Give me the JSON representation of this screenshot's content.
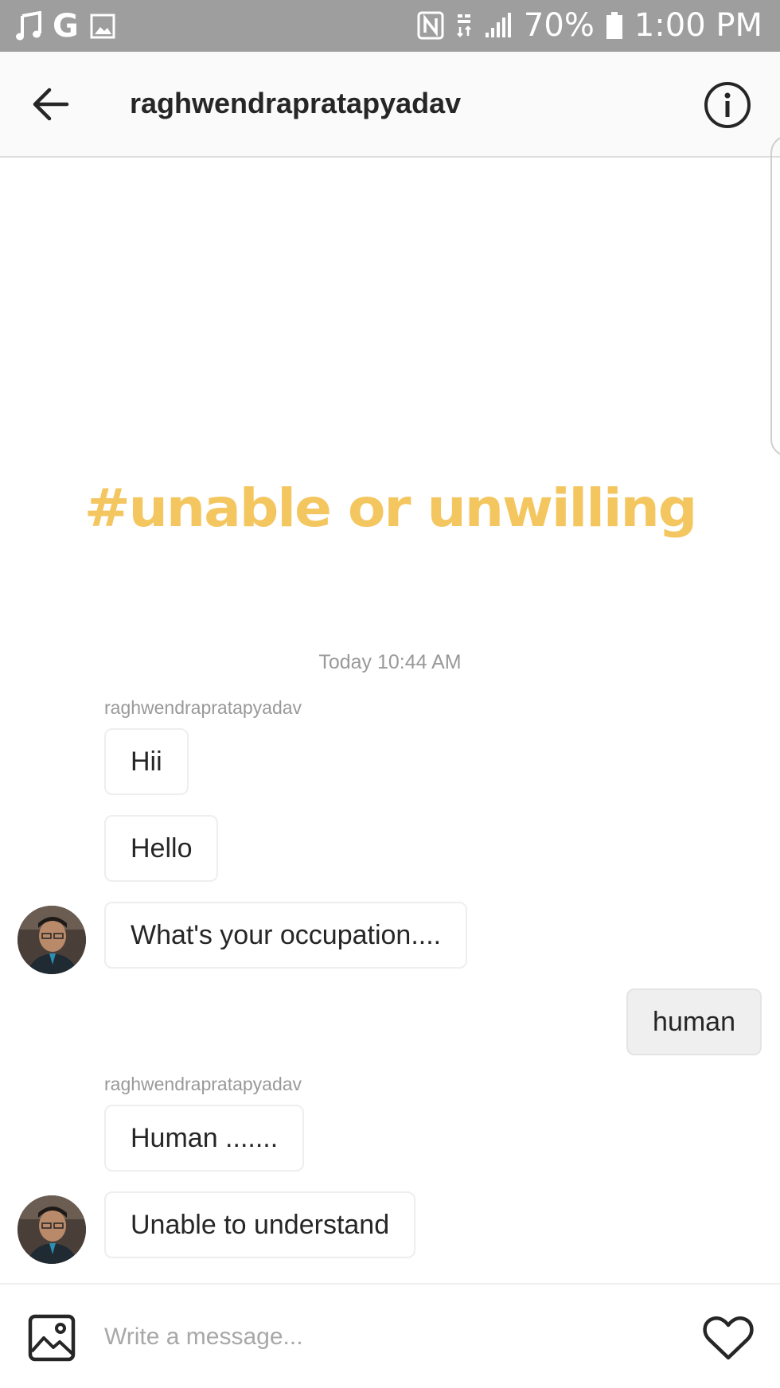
{
  "status_bar": {
    "battery": "70%",
    "time": "1:00 PM"
  },
  "header": {
    "title": "raghwendrapratapyadav"
  },
  "shared_post": {
    "hashtag": "#unable or unwilling"
  },
  "conversation": {
    "timestamp": "Today 10:44 AM",
    "group1_sender": "raghwendrapratapyadav",
    "msg1": "Hii",
    "msg2": "Hello",
    "msg3": "What's your occupation....",
    "reply1": "human",
    "group2_sender": "raghwendrapratapyadav",
    "msg4": "Human .......",
    "msg5": "Unable to understand"
  },
  "composer": {
    "placeholder": "Write a message..."
  },
  "colors": {
    "hashtag": "#f4c65f",
    "status_bar": "#9e9e9e",
    "own_bubble": "#efefef"
  },
  "icons": [
    "music-note-icon",
    "google-g-icon",
    "gallery-icon",
    "nfc-icon",
    "data-4g-icon",
    "signal-icon",
    "battery-icon",
    "back-arrow-icon",
    "info-icon",
    "image-icon",
    "heart-icon"
  ]
}
